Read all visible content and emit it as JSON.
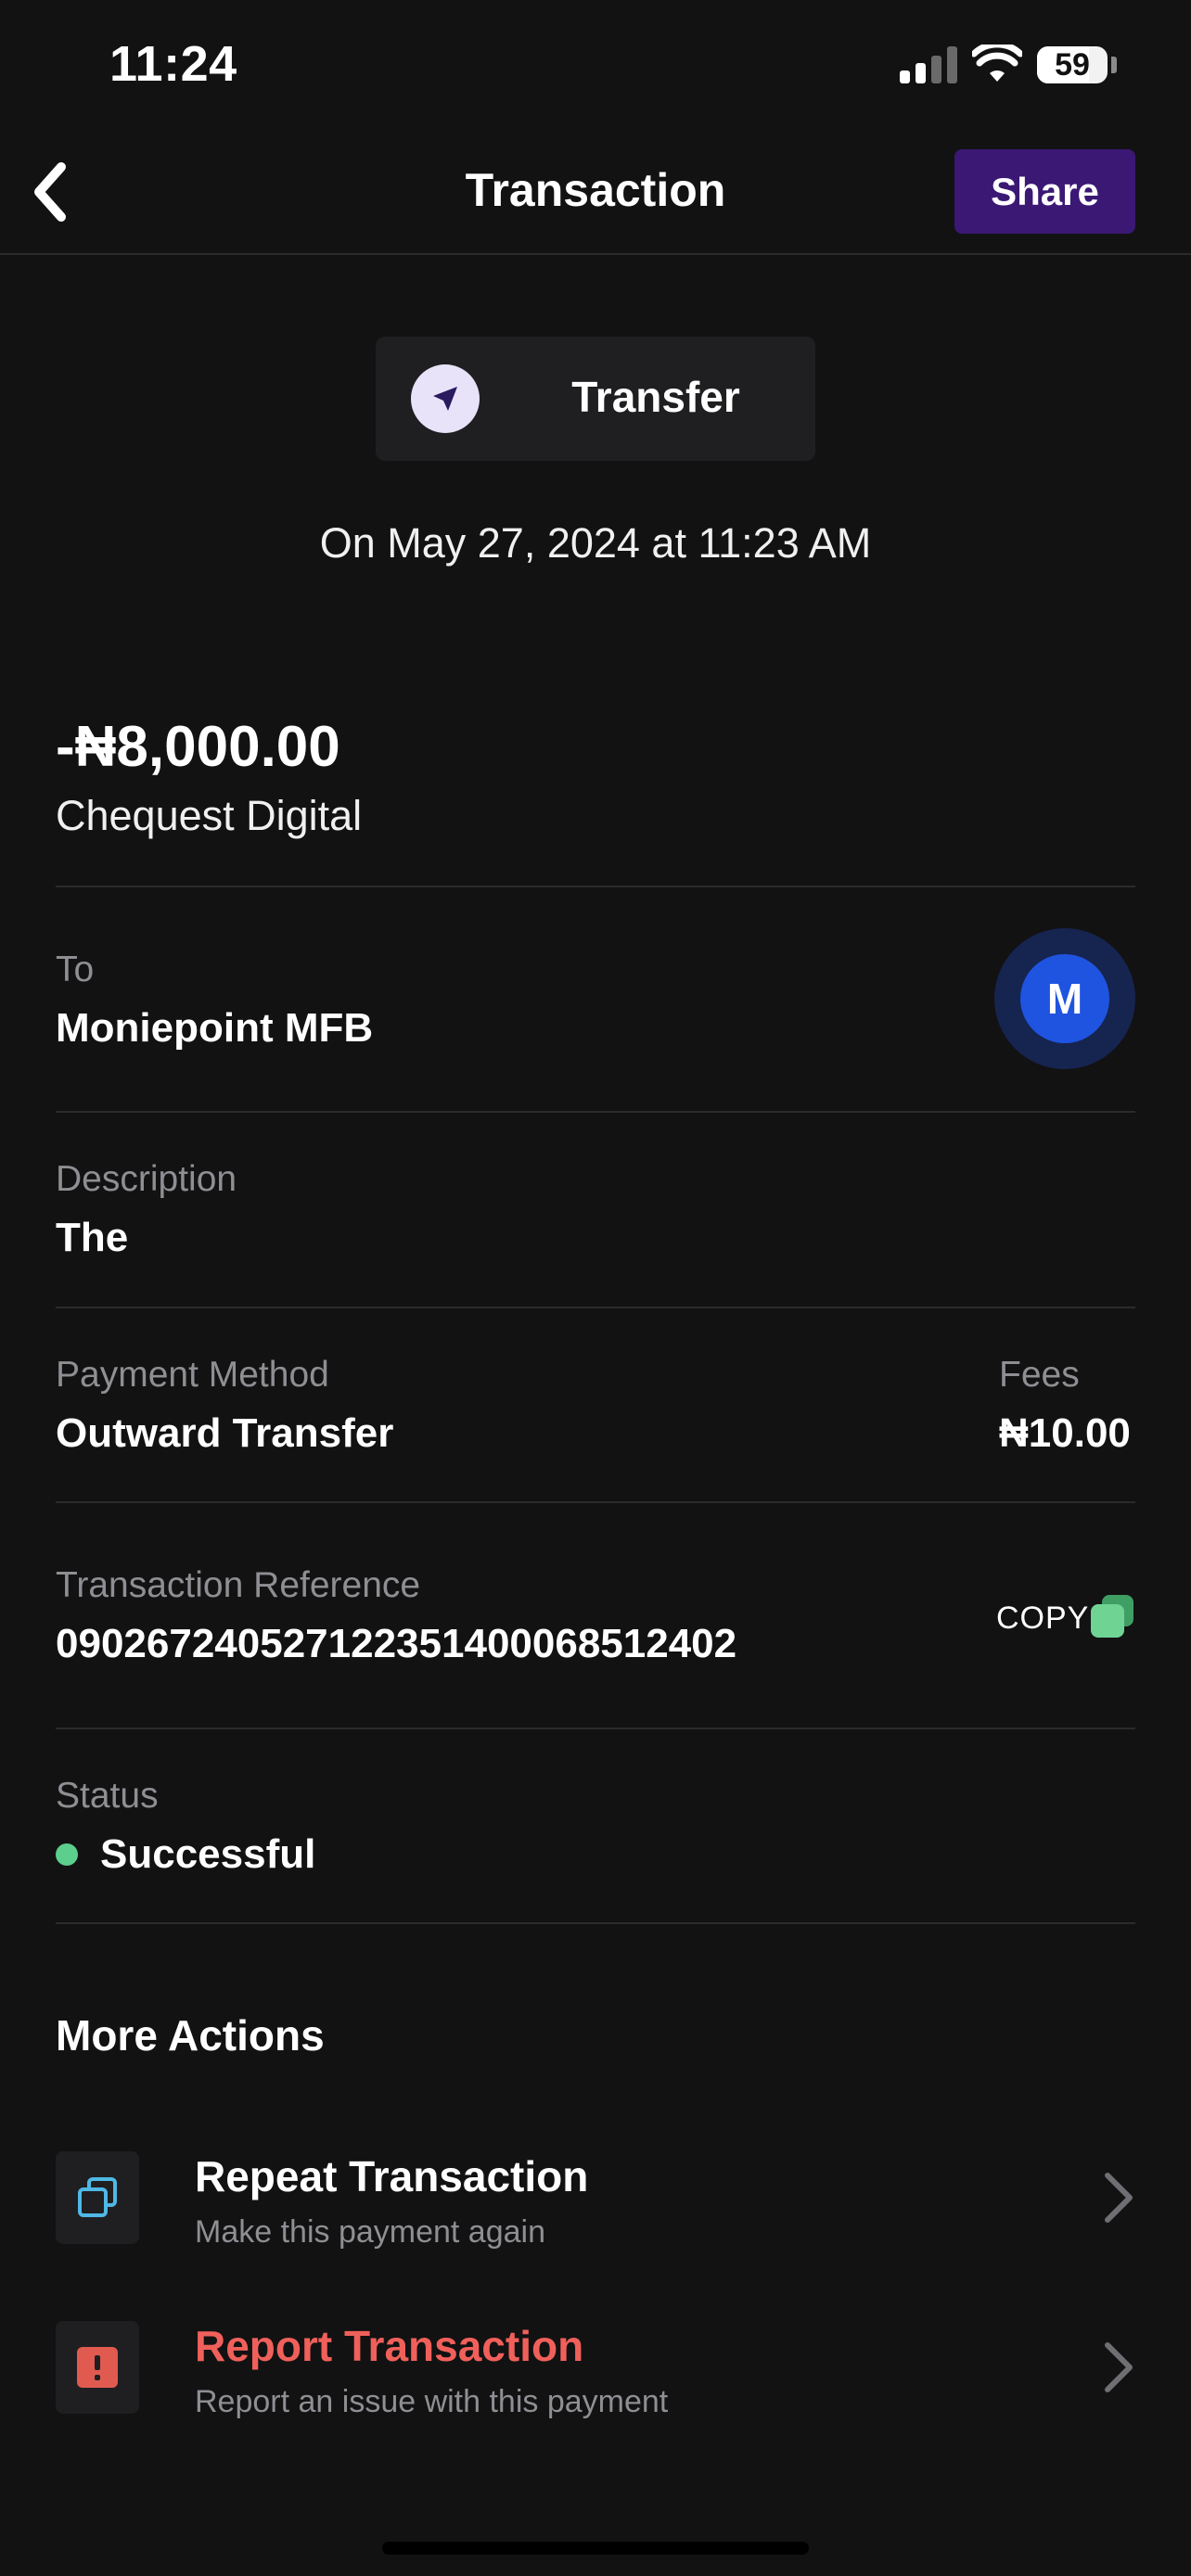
{
  "status_bar": {
    "time": "11:24",
    "battery": "59",
    "icons": [
      "signal-icon",
      "wifi-icon",
      "battery-icon"
    ]
  },
  "header": {
    "title": "Transaction",
    "share_label": "Share",
    "back_icon": "chevron-left-icon"
  },
  "transaction": {
    "type_label": "Transfer",
    "type_icon": "paper-plane-icon",
    "date": "On May 27, 2024 at 11:23 AM",
    "amount": "-₦8,000.00",
    "merchant": "Chequest Digital",
    "to_label": "To",
    "to_value": "Moniepoint MFB",
    "to_avatar_letter": "M",
    "description_label": "Description",
    "description_value": "The",
    "payment_method_label": "Payment Method",
    "payment_method_value": "Outward Transfer",
    "fees_label": "Fees",
    "fees_value": "₦10.00",
    "reference_label": "Transaction Reference",
    "reference_value": "090267240527122351400068512402",
    "copy_label": "COPY",
    "status_label": "Status",
    "status_value": "Successful"
  },
  "more_actions": {
    "title": "More Actions",
    "items": [
      {
        "title": "Repeat Transaction",
        "subtitle": "Make this payment again",
        "icon": "repeat-icon",
        "title_color": "#ffffff"
      },
      {
        "title": "Report Transaction",
        "subtitle": "Report an issue with this payment",
        "icon": "alert-icon",
        "title_color": "#f0605a"
      }
    ]
  },
  "colors": {
    "background": "#121213",
    "share_button": "#3b1874",
    "status_success": "#5ccf8e",
    "avatar_blue": "#1f54e0",
    "report_red": "#f0605a",
    "repeat_icon": "#4fb8e6",
    "copy_icon": "#6fd394"
  }
}
